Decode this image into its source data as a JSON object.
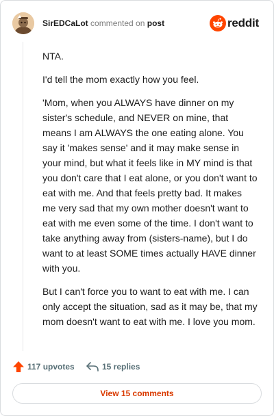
{
  "header": {
    "author": "SirEDCaLot",
    "commented_text": "commented on",
    "post_link": "post",
    "brand": "reddit",
    "brand_color": "#ff4500"
  },
  "comment": {
    "paragraphs": [
      "NTA.",
      "I'd tell the mom exactly how you feel.",
      "'Mom, when you ALWAYS have dinner on my sister's schedule, and NEVER on mine, that means I am ALWAYS the one eating alone. You say it 'makes sense' and it may make sense in your mind, but what it feels like in MY mind is that you don't care that I eat alone, or you don't want to eat with me. And that feels pretty bad. It makes me very sad that my own mother doesn't want to eat with me even some of the time. I don't want to take anything away from (sisters-name), but I do want to at least SOME times actually HAVE dinner with you.",
      "But I can't force you to want to eat with me. I can only accept the situation, sad as it may be, that my mom doesn't want to eat with me. I love you mom."
    ]
  },
  "actions": {
    "upvotes": "117 upvotes",
    "replies": "15 replies",
    "upvote_icon": "upvote-arrow-icon",
    "reply_icon": "reply-arrow-icon",
    "upvote_color": "#ff4500"
  },
  "footer": {
    "view_comments": "View 15 comments",
    "accent": "#d93a00"
  }
}
